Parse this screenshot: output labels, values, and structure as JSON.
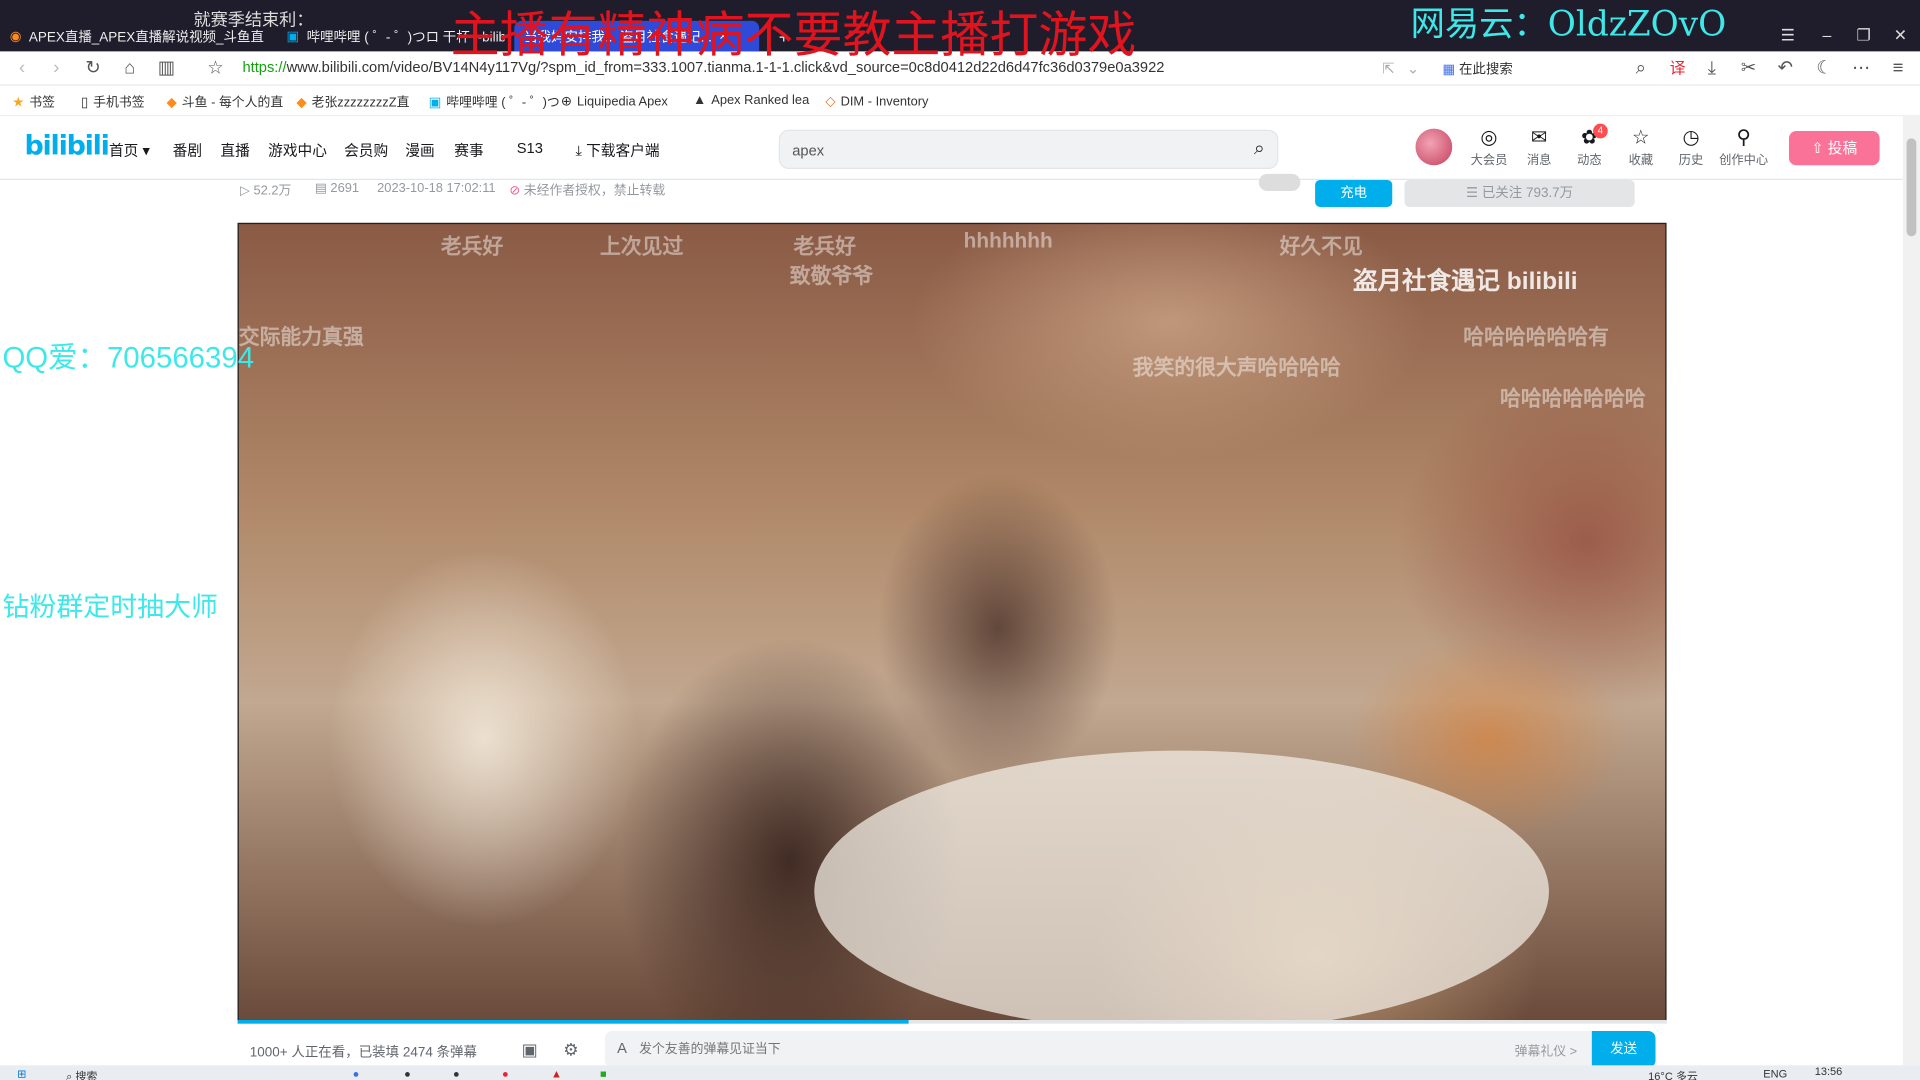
{
  "browser": {
    "tabs": [
      {
        "title": "APEX直播_APEX直播解说视频_斗鱼直",
        "active": false
      },
      {
        "title": "哔哩哔哩 ( ゜- ゜)つロ 干杯~-bilibili",
        "active": false
      },
      {
        "title": "当我妈安排我... 盗月社食遇记...",
        "active": true
      }
    ],
    "tab_prefix": "就赛季结束利：",
    "new_tab": "+",
    "url_proto": "https://",
    "url_rest": "www.bilibili.com/video/BV14N4y117Vg/?spm_id_from=333.1007.tianma.1-1-1.click&vd_source=0c8d0412d22d6d47fc36d0379e0a3922",
    "search_engine_label": "在此搜索",
    "window_buttons": [
      "☰",
      "–",
      "❐",
      "✕"
    ]
  },
  "bookmarks": [
    {
      "label": "书签",
      "icon": "★"
    },
    {
      "label": "手机书签",
      "icon": "▯"
    },
    {
      "label": "斗鱼 - 每个人的直",
      "icon": "◆"
    },
    {
      "label": "老张zzzzzzzzZ直",
      "icon": "◆"
    },
    {
      "label": "哔哩哔哩 ( ゜- ゜)つ",
      "icon": "▣"
    },
    {
      "label": "Liquipedia Apex",
      "icon": "⊕"
    },
    {
      "label": "Apex Ranked lea",
      "icon": "▲"
    },
    {
      "label": "DIM - Inventory",
      "icon": "◇"
    }
  ],
  "site": {
    "logo": "bilibili",
    "nav": [
      "首页 ▾",
      "番剧",
      "直播",
      "游戏中心",
      "会员购",
      "漫画",
      "赛事",
      "S13",
      "下载客户端"
    ],
    "search_value": "apex",
    "right_icons": [
      {
        "label": "大会员",
        "icon": "◎",
        "badge": ""
      },
      {
        "label": "消息",
        "icon": "✉",
        "badge": ""
      },
      {
        "label": "动态",
        "icon": "✿",
        "badge": "4"
      },
      {
        "label": "收藏",
        "icon": "☆",
        "badge": ""
      },
      {
        "label": "历史",
        "icon": "◷",
        "badge": ""
      },
      {
        "label": "创作中心",
        "icon": "⚲",
        "badge": ""
      }
    ],
    "upload_label": "⇧ 投稿"
  },
  "video_meta": {
    "views": "52.2万",
    "danmaku_count": "2691",
    "date": "2023-10-18 17:02:11",
    "copyright": "未经作者授权，禁止转载",
    "charge_label": "充电",
    "follow_label": "☰ 已关注 793.7万"
  },
  "video": {
    "watermark": "盗月社食遇记 bilibili",
    "danmaku": [
      "老兵好",
      "上次见过",
      "老兵好",
      "hhhhhhh",
      "好久不见",
      "致敬爷爷",
      "交际能力真强",
      "哈哈哈哈哈哈有",
      "我笑的很大声哈哈哈哈",
      "哈哈哈哈哈哈哈"
    ],
    "progress": 0.47
  },
  "danmaku_bar": {
    "watching": "1000+ 人正在看，已装填 2474 条弹幕",
    "input_placeholder": "发个友善的弹幕见证当下",
    "etiquette": "弹幕礼仪 >",
    "send_label": "发送"
  },
  "overlays": {
    "red_title": "主播有精神病不要教主播打游戏",
    "music": "网易云：OldzZOvO",
    "qq": "QQ爱：706566394",
    "fans": "钻粉群定时抽大师"
  },
  "taskbar": {
    "search": "搜索",
    "weather": "16°C 多云",
    "lang": "ENG",
    "time": "13:56"
  }
}
